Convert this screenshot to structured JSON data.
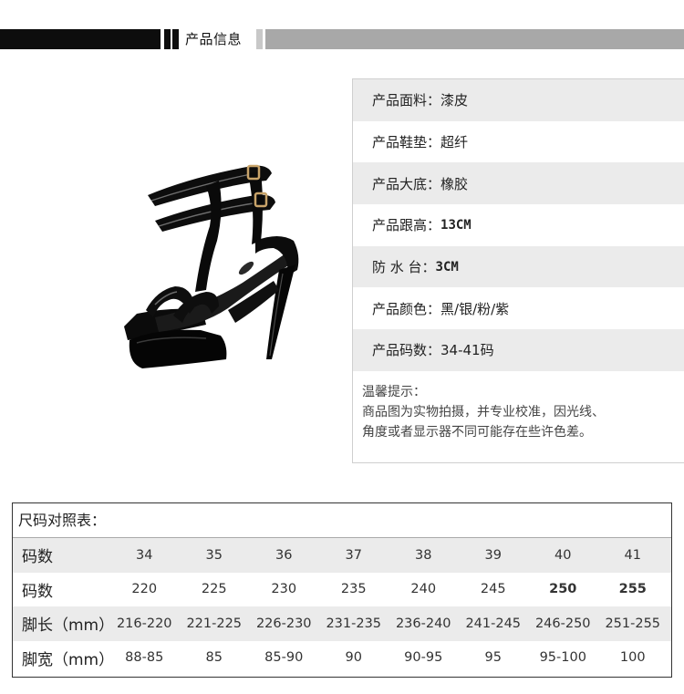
{
  "header": {
    "title": "产品信息"
  },
  "info": {
    "rows": [
      {
        "label": "产品面料：",
        "value": "漆皮"
      },
      {
        "label": "产品鞋垫：",
        "value": "超纤"
      },
      {
        "label": "产品大底：",
        "value": "橡胶"
      },
      {
        "label": "产品跟高：",
        "value": "13CM"
      },
      {
        "label": "防 水 台：",
        "value": "3CM"
      },
      {
        "label": "产品颜色：",
        "value": "黑/银/粉/紫"
      },
      {
        "label": "产品码数：",
        "value": "34-41码"
      }
    ],
    "tips": {
      "title": "温馨提示：",
      "line1": "商品图为实物拍摄，并专业校准，因光线、",
      "line2": "角度或者显示器不同可能存在些许色差。"
    }
  },
  "size_table": {
    "title": "尺码对照表：",
    "rows": [
      {
        "head": "码数",
        "cells": [
          "34",
          "35",
          "36",
          "37",
          "38",
          "39",
          "40",
          "41"
        ]
      },
      {
        "head": "码数",
        "cells": [
          "220",
          "225",
          "230",
          "235",
          "240",
          "245",
          "250",
          "255"
        ]
      },
      {
        "head": "脚长（mm）",
        "cells": [
          "216-220",
          "221-225",
          "226-230",
          "231-235",
          "236-240",
          "241-245",
          "246-250",
          "251-255"
        ]
      },
      {
        "head": "脚宽（mm）",
        "cells": [
          "88-85",
          "85",
          "85-90",
          "90",
          "90-95",
          "95",
          "95-100",
          "100"
        ]
      }
    ]
  },
  "colors": {
    "header_dark": "#0d0d0d",
    "header_gray": "#a8a8a8",
    "row_shade": "#ebebeb",
    "shoe": "#111111",
    "buckle": "#c9a46a"
  }
}
